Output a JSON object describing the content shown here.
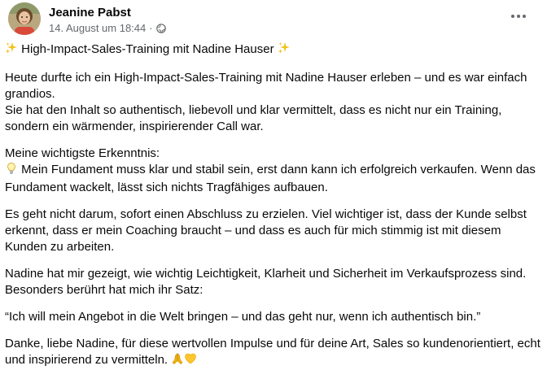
{
  "author": {
    "name": "Jeanine Pabst",
    "date": "14. August um 18:44",
    "separator": "·"
  },
  "icons": {
    "audience": "globe-icon",
    "more": "more-horizontal-icon",
    "sparkle": "sparkles-icon",
    "idea": "light-bulb-icon",
    "hands": "folded-hands-icon",
    "heart": "yellow-heart-icon"
  },
  "colors": {
    "text": "#080809",
    "secondary": "#65686c",
    "sparkle": "#f2c21b"
  },
  "post": {
    "title": "High-Impact-Sales-Training mit Nadine Hauser",
    "p1_l1": "Heute durfte ich ein High-Impact-Sales-Training mit Nadine Hauser erleben – und es war einfach",
    "p1_l2": "grandios.",
    "p1_l3": "Sie hat den Inhalt so authentisch, liebevoll und klar vermittelt, dass es nicht nur ein Training,",
    "p1_l4": "sondern ein wärmender, inspirierender Call war.",
    "p2_l1": "Meine wichtigste Erkenntnis:",
    "p2_l2": "Mein Fundament muss klar und stabil sein, erst dann kann ich erfolgreich verkaufen. Wenn das",
    "p2_l3": "Fundament wackelt, lässt sich nichts Tragfähiges aufbauen.",
    "p3_l1": "Es geht nicht darum, sofort einen Abschluss zu erzielen. Viel wichtiger ist, dass der Kunde selbst",
    "p3_l2": "erkennt, dass er mein Coaching braucht – und dass es auch für mich stimmig ist mit diesem",
    "p3_l3": "Kunden zu arbeiten.",
    "p4_l1": "Nadine hat mir gezeigt, wie wichtig Leichtigkeit, Klarheit und Sicherheit im Verkaufsprozess sind.",
    "p4_l2": "Besonders berührt hat mich ihr Satz:",
    "p5_l1": "“Ich will mein Angebot in die Welt bringen – und das geht nur, wenn ich authentisch bin.”",
    "p6_l1": "Danke, liebe Nadine, für diese wertvollen Impulse und für deine Art, Sales so kundenorientiert, echt",
    "p6_l2": "und inspirierend zu vermitteln."
  }
}
